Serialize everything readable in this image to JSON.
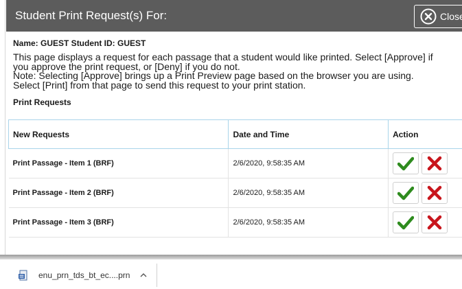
{
  "dialog": {
    "title": "Student Print Request(s) For:",
    "close_label": "Close",
    "student_line": "Name: GUEST Student ID: GUEST",
    "description_lines": [
      "This page displays a request for each passage that a student would like printed. Select [Approve] if",
      "you approve the print request, or [Deny] if you do not.",
      "Note: Selecting [Approve] brings up a Print Preview page based on the browser you are using.",
      "Select [Print] from that page to send this request to your print station."
    ],
    "section_title": "Print Requests"
  },
  "table": {
    "headers": [
      "New Requests",
      "Date and Time",
      "Action"
    ],
    "rows": [
      {
        "name": "Print Passage - Item 1 (BRF)",
        "datetime": "2/6/2020, 9:58:35 AM"
      },
      {
        "name": "Print Passage - Item 2 (BRF)",
        "datetime": "2/6/2020, 9:58:35 AM"
      },
      {
        "name": "Print Passage - Item 3 (BRF)",
        "datetime": "2/6/2020, 9:58:35 AM"
      }
    ]
  },
  "download_shelf": {
    "filename": "enu_prn_tds_bt_ec....prn"
  },
  "colors": {
    "titlebar": "#5c5c5c",
    "approve": "#2e8b1e",
    "deny": "#c8151c",
    "table_border": "#a9d4ea"
  },
  "icons": {
    "close": "close-circle-x-icon",
    "approve": "checkmark-icon",
    "deny": "x-mark-icon",
    "file": "file-icon",
    "chevron": "chevron-up-icon"
  }
}
